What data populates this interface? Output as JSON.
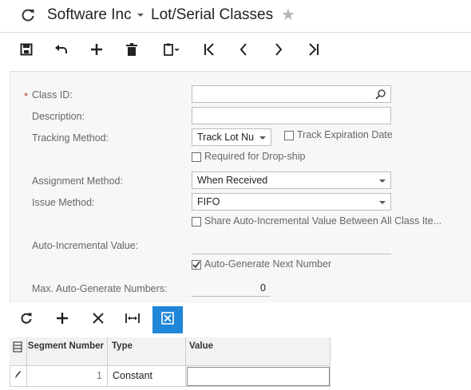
{
  "header": {
    "company": "Software Inc",
    "screen_title": "Lot/Serial Classes"
  },
  "toolbar": {
    "buttons": [
      "save-icon",
      "undo-icon",
      "add-icon",
      "delete-icon",
      "paste-icon",
      "first-icon",
      "previous-icon",
      "next-icon",
      "last-icon"
    ]
  },
  "form": {
    "class_id_label": "Class ID:",
    "class_id_value": "",
    "description_label": "Description:",
    "description_value": "",
    "tracking_method_label": "Tracking Method:",
    "tracking_method_value": "Track Lot Nu",
    "track_expiration_label": "Track Expiration Date",
    "track_expiration_checked": false,
    "required_dropship_label": "Required for Drop-ship",
    "required_dropship_checked": false,
    "assignment_method_label": "Assignment Method:",
    "assignment_method_value": "When Received",
    "issue_method_label": "Issue Method:",
    "issue_method_value": "FIFO",
    "share_auto_label": "Share Auto-Incremental Value Between All Class Ite...",
    "share_auto_checked": false,
    "auto_incremental_label": "Auto-Incremental Value:",
    "auto_incremental_value": "",
    "auto_generate_label": "Auto-Generate Next Number",
    "auto_generate_checked": true,
    "max_auto_label": "Max. Auto-Generate Numbers:",
    "max_auto_value": "0"
  },
  "grid": {
    "toolbar": [
      "refresh-icon",
      "add-icon",
      "delete-icon",
      "fit-width-icon",
      "export-excel-icon"
    ],
    "columns": {
      "segment_number": "Segment Number",
      "type": "Type",
      "value": "Value"
    },
    "rows": [
      {
        "segment_number": "1",
        "type": "Constant",
        "value": ""
      }
    ]
  },
  "colors": {
    "accent": "#1f86d8",
    "required_star": "#cc3b2e",
    "panel_bg": "#f7f7f7"
  }
}
